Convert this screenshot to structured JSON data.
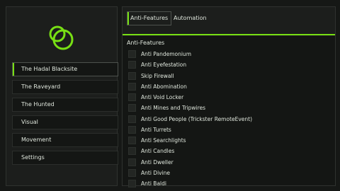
{
  "sidebar": {
    "items": [
      {
        "label": "The Hadal Blacksite",
        "active": true
      },
      {
        "label": "The Raveyard"
      },
      {
        "label": "The Hunted"
      },
      {
        "label": "Visual"
      },
      {
        "label": "Movement"
      },
      {
        "label": "Settings"
      }
    ]
  },
  "tabs": [
    {
      "label": "Anti-Features",
      "active": true
    },
    {
      "label": "Automation"
    }
  ],
  "section": {
    "title": "Anti-Features",
    "toggles": [
      {
        "label": "Anti Pandemonium",
        "checked": false
      },
      {
        "label": "Anti Eyefestation",
        "checked": false
      },
      {
        "label": "Skip Firewall",
        "checked": false
      },
      {
        "label": "Anti Abomination",
        "checked": false
      },
      {
        "label": "Anti Void Locker",
        "checked": false
      },
      {
        "label": "Anti Mines and Tripwires",
        "checked": false
      },
      {
        "label": "Anti Good People (Trickster RemoteEvent)",
        "checked": false
      },
      {
        "label": "Anti Turrets",
        "checked": false
      },
      {
        "label": "Anti Searchlights",
        "checked": false
      },
      {
        "label": "Anti Candles",
        "checked": false
      },
      {
        "label": "Anti Dweller",
        "checked": false
      },
      {
        "label": "Anti Divine",
        "checked": false
      },
      {
        "label": "Anti Baldi",
        "checked": false
      }
    ]
  },
  "colors": {
    "accent": "#78e014",
    "background": "#161816",
    "panel": "#1c1e1c"
  }
}
